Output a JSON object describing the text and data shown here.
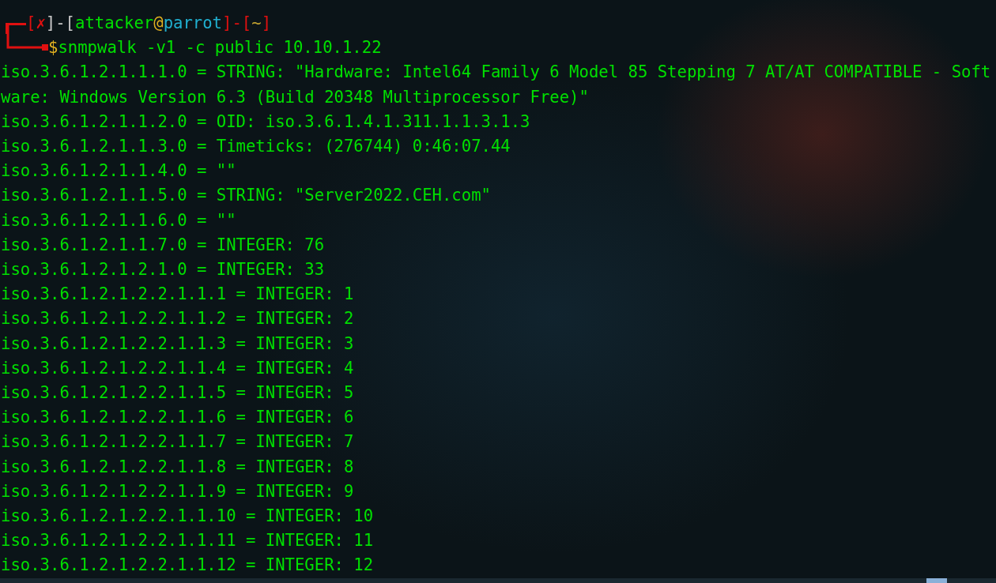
{
  "prompt": {
    "segments": [
      {
        "text": "[",
        "kind": "bracket"
      },
      {
        "text": "✗",
        "kind": "status"
      },
      {
        "text": "]-[",
        "kind": "plain"
      },
      {
        "text": "attacker",
        "kind": "user"
      },
      {
        "text": "@",
        "kind": "at"
      },
      {
        "text": "parrot",
        "kind": "host"
      },
      {
        "text": "]-[",
        "kind": "bracket"
      },
      {
        "text": "~",
        "kind": "dir"
      },
      {
        "text": "]",
        "kind": "bracket"
      }
    ],
    "symbol": "$",
    "command": "snmpwalk -v1 -c public 10.10.1.22"
  },
  "output": [
    "iso.3.6.1.2.1.1.1.0 = STRING: \"Hardware: Intel64 Family 6 Model 85 Stepping 7 AT/AT COMPATIBLE - Soft",
    "ware: Windows Version 6.3 (Build 20348 Multiprocessor Free)\"",
    "iso.3.6.1.2.1.1.2.0 = OID: iso.3.6.1.4.1.311.1.1.3.1.3",
    "iso.3.6.1.2.1.1.3.0 = Timeticks: (276744) 0:46:07.44",
    "iso.3.6.1.2.1.1.4.0 = \"\"",
    "iso.3.6.1.2.1.1.5.0 = STRING: \"Server2022.CEH.com\"",
    "iso.3.6.1.2.1.1.6.0 = \"\"",
    "iso.3.6.1.2.1.1.7.0 = INTEGER: 76",
    "iso.3.6.1.2.1.2.1.0 = INTEGER: 33",
    "iso.3.6.1.2.1.2.2.1.1.1 = INTEGER: 1",
    "iso.3.6.1.2.1.2.2.1.1.2 = INTEGER: 2",
    "iso.3.6.1.2.1.2.2.1.1.3 = INTEGER: 3",
    "iso.3.6.1.2.1.2.2.1.1.4 = INTEGER: 4",
    "iso.3.6.1.2.1.2.2.1.1.5 = INTEGER: 5",
    "iso.3.6.1.2.1.2.2.1.1.6 = INTEGER: 6",
    "iso.3.6.1.2.1.2.2.1.1.7 = INTEGER: 7",
    "iso.3.6.1.2.1.2.2.1.1.8 = INTEGER: 8",
    "iso.3.6.1.2.1.2.2.1.1.9 = INTEGER: 9",
    "iso.3.6.1.2.1.2.2.1.1.10 = INTEGER: 10",
    "iso.3.6.1.2.1.2.2.1.1.11 = INTEGER: 11",
    "iso.3.6.1.2.1.2.2.1.1.12 = INTEGER: 12"
  ]
}
